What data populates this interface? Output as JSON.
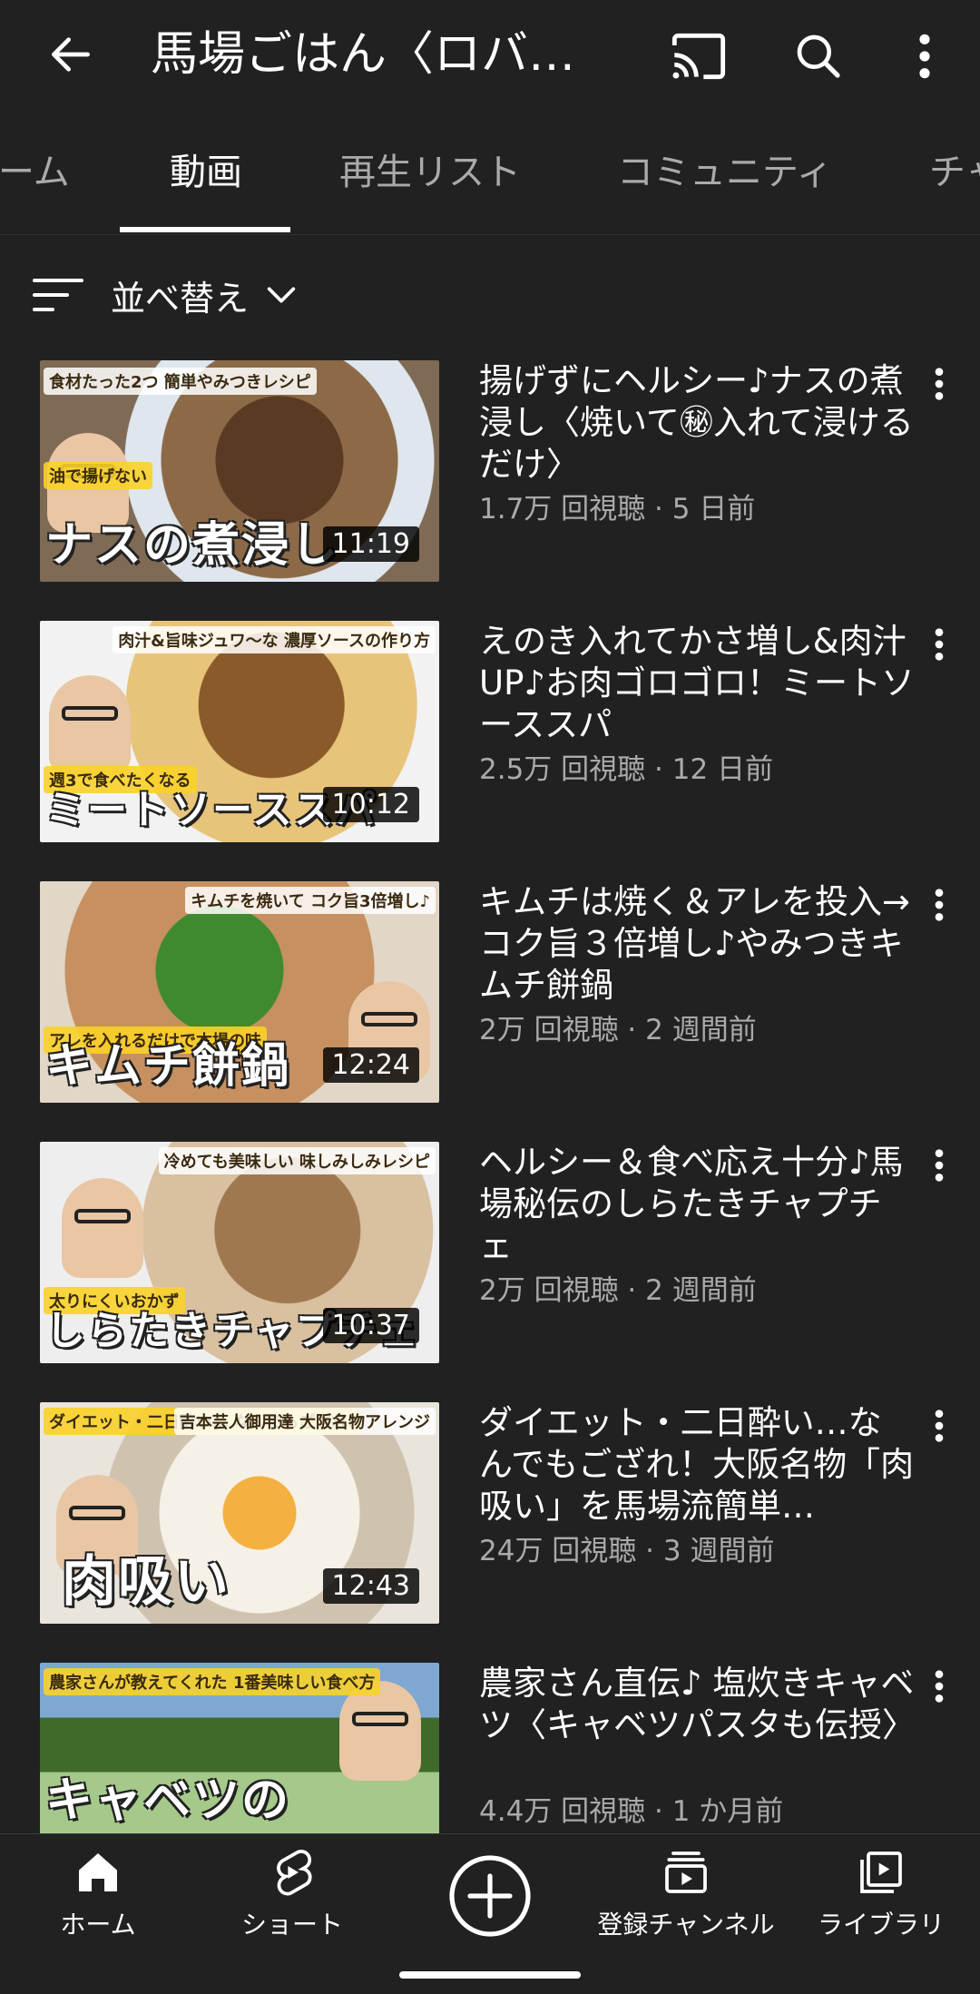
{
  "header": {
    "title": "馬場ごはん〈ロバ…"
  },
  "tabs": [
    {
      "label": "ーム",
      "active": false
    },
    {
      "label": "動画",
      "active": true
    },
    {
      "label": "再生リスト",
      "active": false
    },
    {
      "label": "コミュニティ",
      "active": false
    },
    {
      "label": "チャ",
      "active": false
    }
  ],
  "sort": {
    "label": "並べ替え"
  },
  "videos": [
    {
      "title": "揚げずにヘルシー♪ナスの煮浸し〈焼いて㊙入れて浸けるだけ〉",
      "meta": "1.7万 回視聴 · 5 日前",
      "duration": "11:19",
      "thumb_text": "ナスの煮浸し",
      "thumb_sub": "食材たった2つ 簡単やみつきレシピ",
      "thumb_sub2": "油で揚げない",
      "thumb_color": "#7a5a3a"
    },
    {
      "title": "えのき入れてかさ増し&肉汁UP♪お肉ゴロゴロ！ミートソーススパ",
      "meta": "2.5万 回視聴 · 12 日前",
      "duration": "10:12",
      "thumb_text": "ミートソーススパ",
      "thumb_sub": "肉汁&旨味ジュワ〜な 濃厚ソースの作り方",
      "thumb_sub2": "週3で食べたくなる",
      "thumb_color": "#c9a05a"
    },
    {
      "title": "キムチは焼く＆アレを投入→コク旨３倍増し♪やみつきキムチ餅鍋",
      "meta": "2万 回視聴 · 2 週間前",
      "duration": "12:24",
      "thumb_text": "キムチ餅鍋",
      "thumb_sub": "キムチを焼いて コク旨3倍増し♪",
      "thumb_sub2": "アレを入れるだけで本場の味",
      "thumb_color": "#c88a4a"
    },
    {
      "title": "ヘルシー＆食べ応え十分♪馬場秘伝のしらたきチャプチェ",
      "meta": "2万 回視聴 · 2 週間前",
      "duration": "10:37",
      "thumb_text": "しらたきチャプチェ",
      "thumb_sub": "冷めても美味しい 味しみしみレシピ",
      "thumb_sub2": "太りにくいおかず",
      "thumb_color": "#b49a78"
    },
    {
      "title": "ダイエット・二日酔い…なんでもござれ！大阪名物「肉吸い」を馬場流簡単…",
      "meta": "24万 回視聴 · 3 週間前",
      "duration": "12:43",
      "thumb_text": "肉吸い",
      "thumb_sub": "吉本芸人御用達 大阪名物アレンジ",
      "thumb_sub2": "ダイエット・二日酔い… なんでもござれ!",
      "thumb_color": "#d8cdb8"
    },
    {
      "title": "農家さん直伝♪ 塩炊きキャベツ〈キャベツパスタも伝授〉",
      "meta": "4.4万 回視聴 · 1 か月前",
      "duration": "",
      "thumb_text": "キャベツの",
      "thumb_sub": "農家さんが教えてくれた 1番美味しい食べ方",
      "thumb_sub2": "",
      "thumb_color": "#8fb07a"
    }
  ],
  "nav": [
    {
      "label": "ホーム",
      "icon": "home-icon"
    },
    {
      "label": "ショート",
      "icon": "shorts-icon"
    },
    {
      "label": "",
      "icon": "create-icon"
    },
    {
      "label": "登録チャンネル",
      "icon": "subscriptions-icon"
    },
    {
      "label": "ライブラリ",
      "icon": "library-icon"
    }
  ]
}
